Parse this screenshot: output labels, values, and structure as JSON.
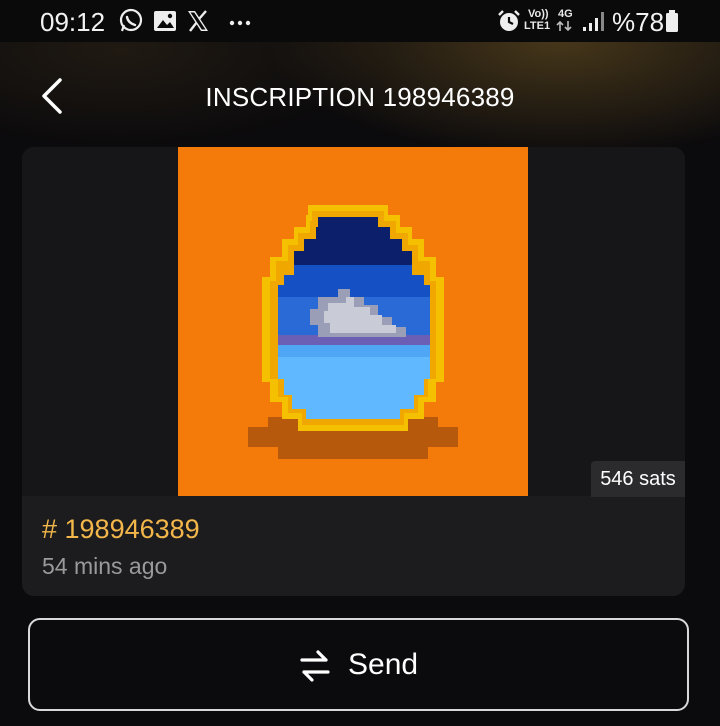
{
  "status_bar": {
    "time": "09:12",
    "notification_icons": [
      "whatsapp-icon",
      "gallery-icon",
      "x-icon",
      "more-dots-icon"
    ],
    "network_label_top": "Vo))",
    "network_label_bottom": "LTE1",
    "network_type": "4G",
    "battery_percent": "%78"
  },
  "header": {
    "title": "INSCRIPTION 198946389"
  },
  "inscription": {
    "price": "546 sats",
    "number": "# 198946389",
    "time_ago": "54 mins ago"
  },
  "actions": {
    "send_label": "Send"
  },
  "colors": {
    "accent": "#f2b64a",
    "art_background": "#f47a0a",
    "card": "#1c1c1e"
  }
}
